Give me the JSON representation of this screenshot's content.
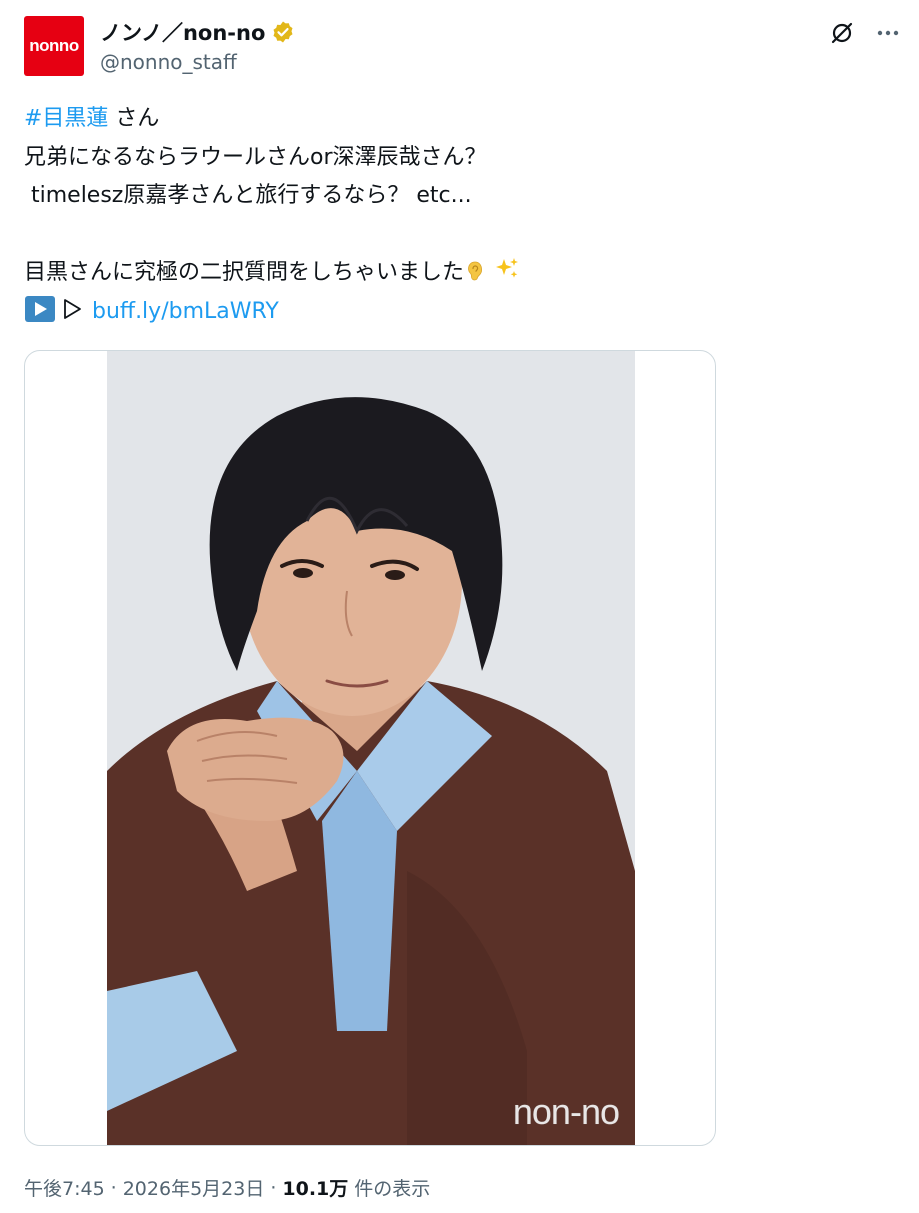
{
  "author": {
    "avatar_logo": "nonno",
    "display_name": "ノンノ／non-no",
    "handle": "@nonno_staff",
    "verified_color": "#e2b719"
  },
  "actions": {
    "grok_icon": "grok-icon",
    "more_icon": "more-icon"
  },
  "text": {
    "hashtag": "#目黒蓮",
    "line1_rest": " さん",
    "line2": "兄弟になるならラウールさんor深澤辰哉さん？",
    "line3": " timelesz原嘉孝さんと旅行するなら？ etc...",
    "line4": "",
    "line5": "目黒さんに究極の二択質問をしちゃいました",
    "line5_emojis": [
      "ear-emoji",
      "sparkles-emoji"
    ],
    "line6_prefix_icons": [
      "play-button-emoji",
      "play-outline-icon"
    ],
    "link": "buff.ly/bmLaWRY"
  },
  "media": {
    "watermark": "non-no"
  },
  "meta": {
    "time": "午後7:45",
    "separator": "·",
    "date": "2026年5月23日",
    "views_count": "10.1万",
    "views_label": "件の表示"
  },
  "colors": {
    "accent": "#1d9bf0",
    "secondary_text": "#536471",
    "brand_red": "#e60012"
  }
}
